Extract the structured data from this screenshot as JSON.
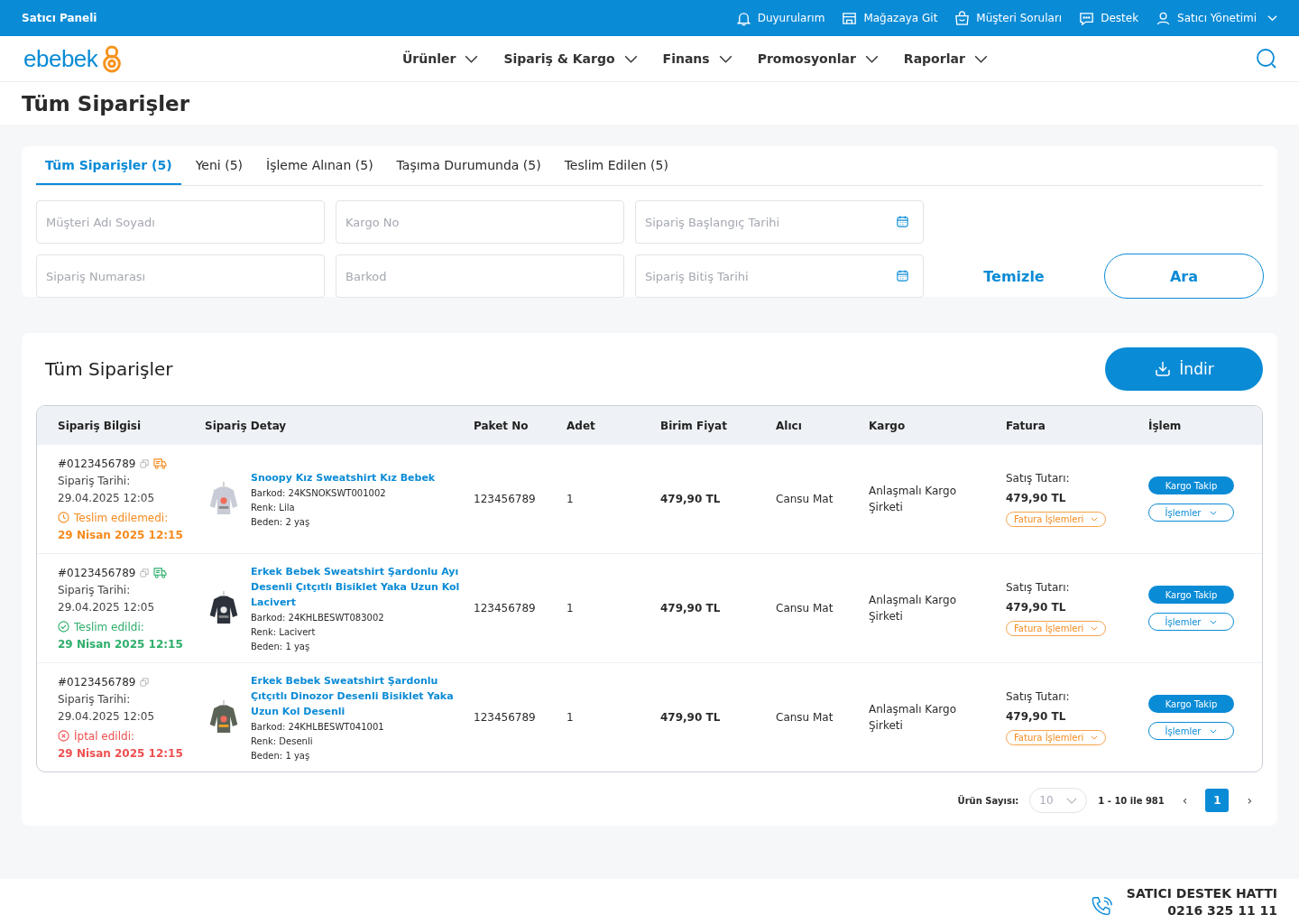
{
  "topbar": {
    "title": "Satıcı Paneli",
    "links": [
      {
        "kind": "bell",
        "label": "Duyurularım"
      },
      {
        "kind": "store",
        "label": "Mağazaya Git"
      },
      {
        "kind": "bag",
        "label": "Müşteri Soruları"
      },
      {
        "kind": "chat",
        "label": "Destek"
      },
      {
        "kind": "user",
        "label": "Satıcı Yönetimi",
        "caret": true
      }
    ]
  },
  "header": {
    "logo": "ebebek",
    "nav": [
      "Ürünler",
      "Sipariş & Kargo",
      "Finans",
      "Promosyonlar",
      "Raporlar"
    ]
  },
  "page_title": "Tüm Siparişler",
  "tabs": [
    {
      "label": "Tüm Siparişler (5)",
      "selected": true
    },
    {
      "label": "Yeni (5)",
      "selected": false
    },
    {
      "label": "İşleme Alınan (5)",
      "selected": false
    },
    {
      "label": "Taşıma Durumunda (5)",
      "selected": false
    },
    {
      "label": "Teslim Edilen (5)",
      "selected": false
    }
  ],
  "filters": [
    {
      "placeholder": "Müşteri Adı Soyadı",
      "kind": "text"
    },
    {
      "placeholder": "Kargo No",
      "kind": "text"
    },
    {
      "placeholder": "Sipariş Başlangıç Tarihi",
      "kind": "date"
    },
    {
      "placeholder": "Sipariş Numarası",
      "kind": "text"
    },
    {
      "placeholder": "Barkod",
      "kind": "text"
    },
    {
      "placeholder": "Sipariş Bitiş Tarihi",
      "kind": "date"
    }
  ],
  "clear_button": "Temizle",
  "search_button": "Ara",
  "orders": {
    "title": "Tüm Siparişler",
    "download_button": "İndir",
    "columns": [
      "Sipariş Bilgisi",
      "Sipariş Detay",
      "Paket No",
      "Adet",
      "Birim Fiyat",
      "Alıcı",
      "Kargo",
      "Fatura",
      "İşlem"
    ],
    "rows": [
      {
        "order_no": "#0123456789",
        "truck_icon": true,
        "date_label": "Sipariş Tarihi:",
        "date": "29.04.2025 12:05",
        "status": {
          "kind": "late",
          "label": "Teslim edilemedi:",
          "date": "29 Nisan 2025 12:15"
        },
        "product": {
          "name": "Snoopy Kız Sweatshirt Kız Bebek",
          "barcode": "Barkod: 24KSNOKSWT001002",
          "variant": "Renk: Lila",
          "size": "Beden: 2 yaş"
        },
        "package_no": "123456789",
        "quantity": "1",
        "unit_price": "479,90 TL",
        "recipient": "Cansu Mat",
        "carrier": "Anlaşmalı Kargo Şirketi",
        "invoice_label": "Satış Tutarı:",
        "invoice_amount": "479,90 TL",
        "invoice_button": "Fatura İşlemleri",
        "track_button": "Kargo Takip",
        "actions_button": "İşlemler"
      },
      {
        "order_no": "#0123456789",
        "truck_icon": true,
        "date_label": "Sipariş Tarihi:",
        "date": "29.04.2025 12:05",
        "status": {
          "kind": "delivered",
          "label": "Teslim edildi:",
          "date": "29 Nisan 2025 12:15"
        },
        "product": {
          "name": "Erkek Bebek Sweatshirt Şardonlu Ayı Desenli Çıtçıtlı Bisiklet Yaka Uzun Kol Lacivert",
          "barcode": "Barkod: 24KHLBESWT083002",
          "variant": "Renk: Lacivert",
          "size": "Beden: 1 yaş"
        },
        "package_no": "123456789",
        "quantity": "1",
        "unit_price": "479,90 TL",
        "recipient": "Cansu Mat",
        "carrier": "Anlaşmalı Kargo Şirketi",
        "invoice_label": "Satış Tutarı:",
        "invoice_amount": "479,90 TL",
        "invoice_button": "Fatura İşlemleri",
        "track_button": "Kargo Takip",
        "actions_button": "İşlemler"
      },
      {
        "order_no": "#0123456789",
        "truck_icon": false,
        "date_label": "Sipariş Tarihi:",
        "date": "29.04.2025 12:05",
        "status": {
          "kind": "cancelled",
          "label": "İptal edildi:",
          "date": "29 Nisan 2025 12:15"
        },
        "product": {
          "name": "Erkek Bebek Sweatshirt Şardonlu Çıtçıtlı Dinozor Desenli Bisiklet Yaka Uzun Kol Desenli",
          "barcode": "Barkod: 24KHLBESWT041001",
          "variant": "Renk: Desenli",
          "size": "Beden: 1 yaş"
        },
        "package_no": "123456789",
        "quantity": "1",
        "unit_price": "479,90 TL",
        "recipient": "Cansu Mat",
        "carrier": "Anlaşmalı Kargo Şirketi",
        "invoice_label": "Satış Tutarı:",
        "invoice_amount": "479,90 TL",
        "invoice_button": "Fatura İşlemleri",
        "track_button": "Kargo Takip",
        "actions_button": "İşlemler"
      }
    ],
    "pagination": {
      "page_size_label": "Ürün Sayısı:",
      "page_size": "10",
      "range": "1 - 10 ile 981",
      "prev": "‹",
      "pages": [
        {
          "label": "1",
          "selected": true
        }
      ],
      "next": "›"
    }
  },
  "footer": {
    "title": "SATICI DESTEK HATTI",
    "phone": "0216 325 11 11"
  }
}
